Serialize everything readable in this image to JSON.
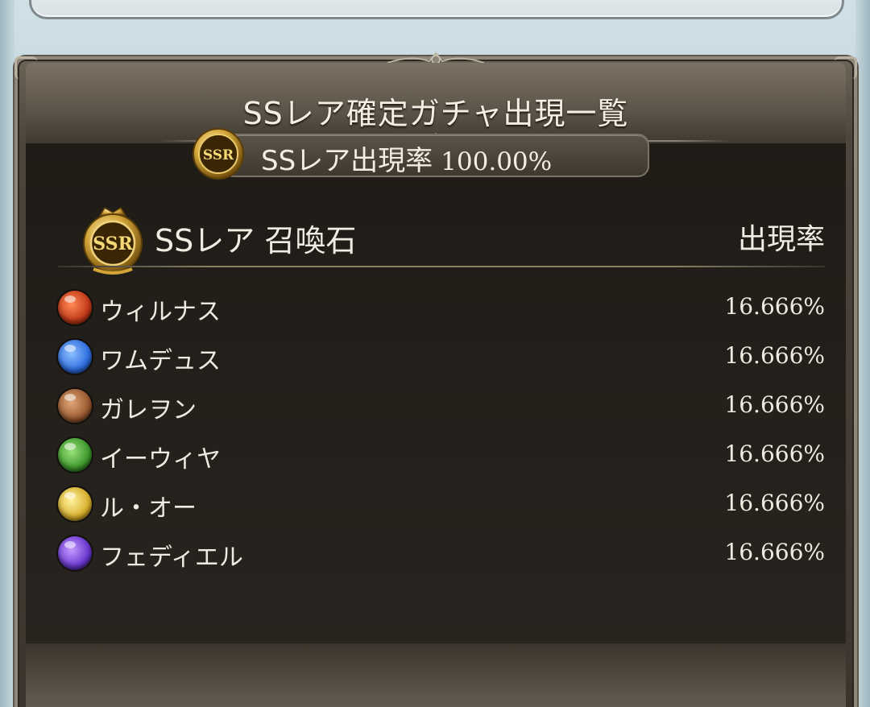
{
  "dialog": {
    "title": "SSレア確定ガチャ出現一覧"
  },
  "rate_summary": {
    "badge_text": "SSR",
    "label": "SSレア出現率",
    "value": "100.00%"
  },
  "section": {
    "badge_text": "SSR",
    "title": "SSレア 召喚石",
    "rate_header": "出現率"
  },
  "items": [
    {
      "name": "ウィルナス",
      "rate": "16.666%",
      "element": "fire",
      "icon": "fire-element-icon"
    },
    {
      "name": "ワムデュス",
      "rate": "16.666%",
      "element": "water",
      "icon": "water-element-icon"
    },
    {
      "name": "ガレヲン",
      "rate": "16.666%",
      "element": "earth",
      "icon": "earth-element-icon"
    },
    {
      "name": "イーウィヤ",
      "rate": "16.666%",
      "element": "wind",
      "icon": "wind-element-icon"
    },
    {
      "name": "ル・オー",
      "rate": "16.666%",
      "element": "light",
      "icon": "light-element-icon"
    },
    {
      "name": "フェディエル",
      "rate": "16.666%",
      "element": "dark",
      "icon": "dark-element-icon"
    }
  ],
  "colors": {
    "panel_dark": "#221e19",
    "frame": "#8f877a",
    "text": "#efeadf",
    "gold": "#d4a83a"
  }
}
